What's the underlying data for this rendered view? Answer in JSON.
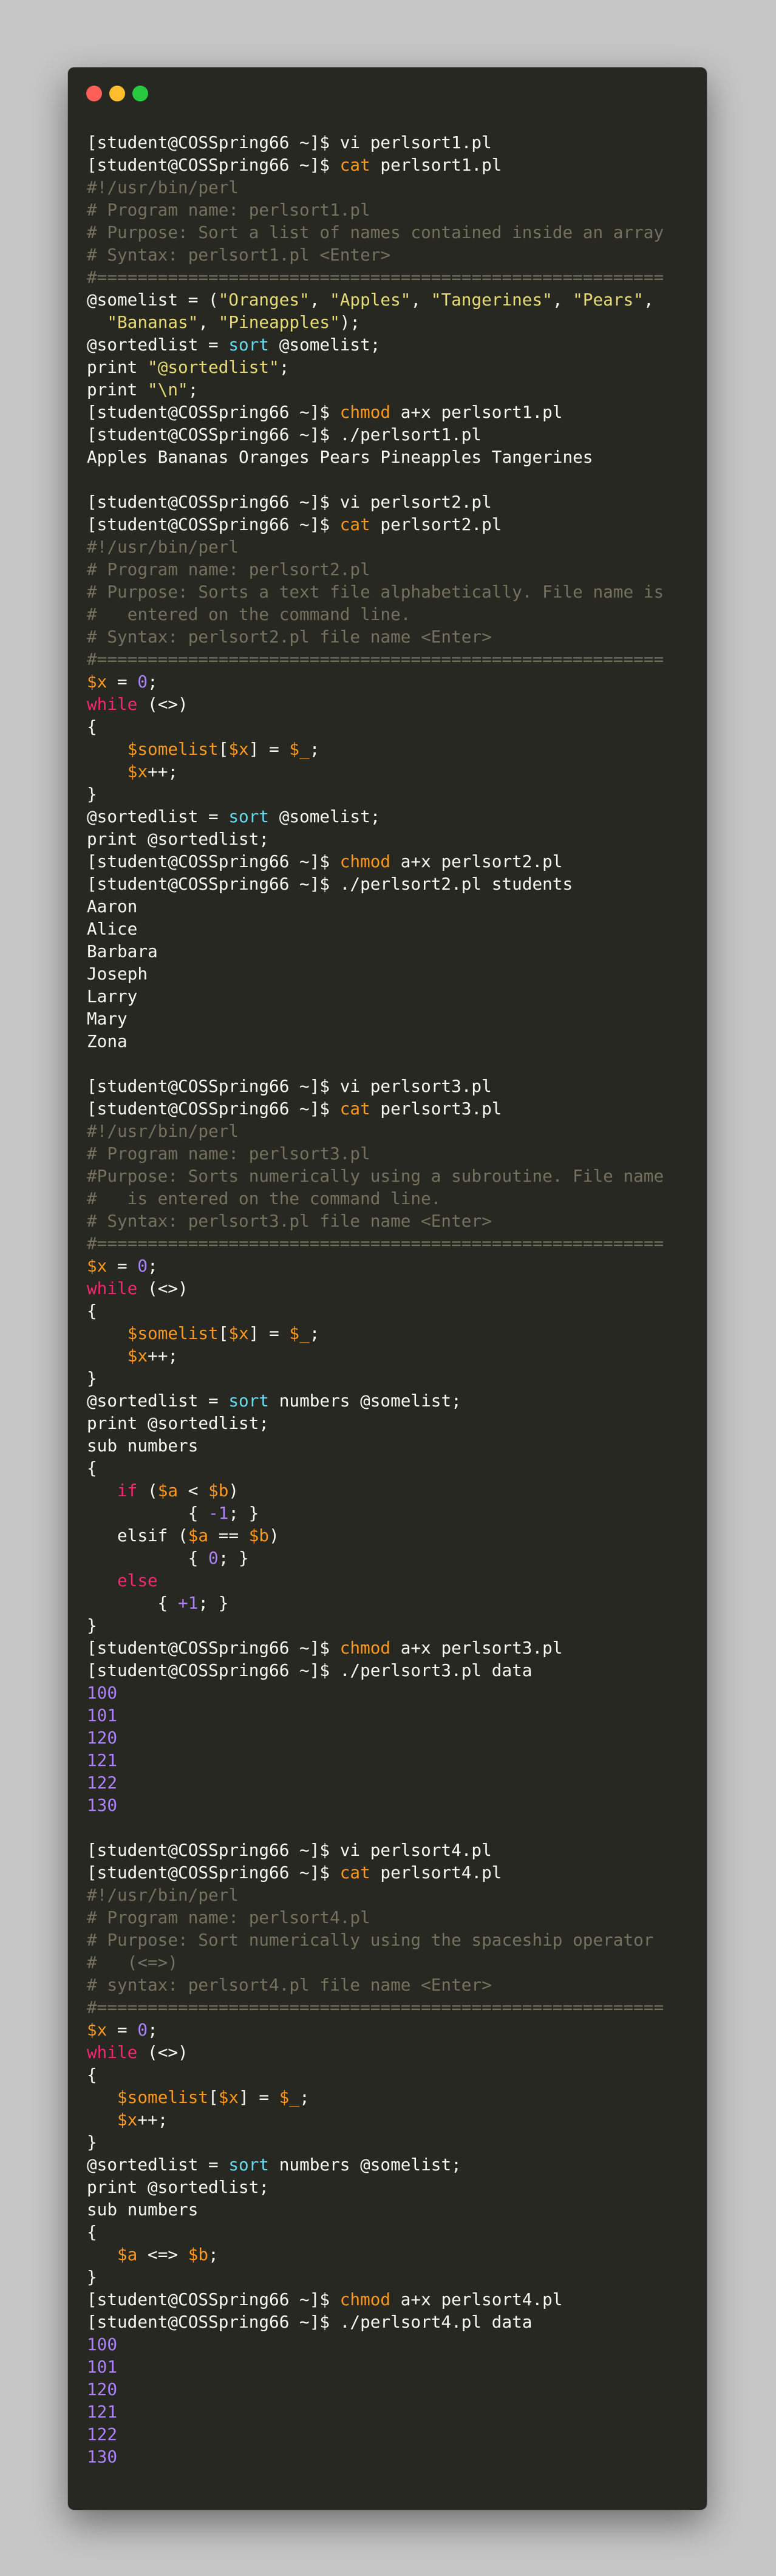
{
  "colors": {
    "background": "#c6c6c6",
    "terminal": "#272822",
    "text": "#f8f8f2",
    "comment": "#75715e",
    "string": "#e6db74",
    "keyword": "#f92672",
    "builtin": "#66d9ef",
    "variable": "#fd971f",
    "number": "#ae81ff"
  },
  "window": {
    "controls": [
      "close",
      "minimize",
      "maximize"
    ]
  },
  "lines": [
    {
      "s": [
        {
          "c": "pr",
          "t": "[student@COSSpring66 ~]$ "
        },
        {
          "c": "cmd",
          "t": "vi perlsort1.pl"
        }
      ]
    },
    {
      "s": [
        {
          "c": "pr",
          "t": "[student@COSSpring66 ~]$ "
        },
        {
          "c": "cmd-hl",
          "t": "cat"
        },
        {
          "c": "cmd",
          "t": " perlsort1.pl"
        }
      ]
    },
    {
      "s": [
        {
          "c": "cm",
          "t": "#!/usr/bin/perl"
        }
      ]
    },
    {
      "s": [
        {
          "c": "cm",
          "t": "# Program name: perlsort1.pl"
        }
      ]
    },
    {
      "s": [
        {
          "c": "cm",
          "t": "# Purpose: Sort a list of names contained inside an array"
        }
      ]
    },
    {
      "s": [
        {
          "c": "cm",
          "t": "# Syntax: perlsort1.pl <Enter>"
        }
      ]
    },
    {
      "s": [
        {
          "c": "cm",
          "t": "#========================================================"
        }
      ]
    },
    {
      "s": [
        {
          "c": "pl",
          "t": "@somelist = ("
        },
        {
          "c": "str",
          "t": "\"Oranges\""
        },
        {
          "c": "pl",
          "t": ", "
        },
        {
          "c": "str",
          "t": "\"Apples\""
        },
        {
          "c": "pl",
          "t": ", "
        },
        {
          "c": "str",
          "t": "\"Tangerines\""
        },
        {
          "c": "pl",
          "t": ", "
        },
        {
          "c": "str",
          "t": "\"Pears\""
        },
        {
          "c": "pl",
          "t": ","
        }
      ]
    },
    {
      "s": [
        {
          "c": "pl",
          "t": "  "
        },
        {
          "c": "str",
          "t": "\"Bananas\""
        },
        {
          "c": "pl",
          "t": ", "
        },
        {
          "c": "str",
          "t": "\"Pineapples\""
        },
        {
          "c": "pl",
          "t": ");"
        }
      ]
    },
    {
      "s": [
        {
          "c": "pl",
          "t": "@sortedlist = "
        },
        {
          "c": "bi",
          "t": "sort"
        },
        {
          "c": "pl",
          "t": " @somelist;"
        }
      ]
    },
    {
      "s": [
        {
          "c": "pl",
          "t": "print "
        },
        {
          "c": "str",
          "t": "\"@sortedlist\""
        },
        {
          "c": "pl",
          "t": ";"
        }
      ]
    },
    {
      "s": [
        {
          "c": "pl",
          "t": "print "
        },
        {
          "c": "str",
          "t": "\"\\n\""
        },
        {
          "c": "pl",
          "t": ";"
        }
      ]
    },
    {
      "s": [
        {
          "c": "pr",
          "t": "[student@COSSpring66 ~]$ "
        },
        {
          "c": "cmd-hl",
          "t": "chmod"
        },
        {
          "c": "cmd",
          "t": " a+x perlsort1.pl"
        }
      ]
    },
    {
      "s": [
        {
          "c": "pr",
          "t": "[student@COSSpring66 ~]$ "
        },
        {
          "c": "cmd",
          "t": "./perlsort1.pl"
        }
      ]
    },
    {
      "s": [
        {
          "c": "out",
          "t": "Apples Bananas Oranges Pears Pineapples Tangerines"
        }
      ]
    },
    {
      "s": []
    },
    {
      "s": [
        {
          "c": "pr",
          "t": "[student@COSSpring66 ~]$ "
        },
        {
          "c": "cmd",
          "t": "vi perlsort2.pl"
        }
      ]
    },
    {
      "s": [
        {
          "c": "pr",
          "t": "[student@COSSpring66 ~]$ "
        },
        {
          "c": "cmd-hl",
          "t": "cat"
        },
        {
          "c": "cmd",
          "t": " perlsort2.pl"
        }
      ]
    },
    {
      "s": [
        {
          "c": "cm",
          "t": "#!/usr/bin/perl"
        }
      ]
    },
    {
      "s": [
        {
          "c": "cm",
          "t": "# Program name: perlsort2.pl"
        }
      ]
    },
    {
      "s": [
        {
          "c": "cm",
          "t": "# Purpose: Sorts a text file alphabetically. File name is"
        }
      ]
    },
    {
      "s": [
        {
          "c": "cm",
          "t": "#   entered on the command line."
        }
      ]
    },
    {
      "s": [
        {
          "c": "cm",
          "t": "# Syntax: perlsort2.pl file name <Enter>"
        }
      ]
    },
    {
      "s": [
        {
          "c": "cm",
          "t": "#========================================================"
        }
      ]
    },
    {
      "s": [
        {
          "c": "var",
          "t": "$x"
        },
        {
          "c": "pl",
          "t": " = "
        },
        {
          "c": "num",
          "t": "0"
        },
        {
          "c": "pl",
          "t": ";"
        }
      ]
    },
    {
      "s": [
        {
          "c": "kw",
          "t": "while"
        },
        {
          "c": "pl",
          "t": " (<>)"
        }
      ]
    },
    {
      "s": [
        {
          "c": "pl",
          "t": "{"
        }
      ]
    },
    {
      "s": [
        {
          "c": "pl",
          "t": "    "
        },
        {
          "c": "var",
          "t": "$somelist"
        },
        {
          "c": "pl",
          "t": "["
        },
        {
          "c": "var",
          "t": "$x"
        },
        {
          "c": "pl",
          "t": "] = "
        },
        {
          "c": "var",
          "t": "$_"
        },
        {
          "c": "pl",
          "t": ";"
        }
      ]
    },
    {
      "s": [
        {
          "c": "pl",
          "t": "    "
        },
        {
          "c": "var",
          "t": "$x"
        },
        {
          "c": "pl",
          "t": "++;"
        }
      ]
    },
    {
      "s": [
        {
          "c": "pl",
          "t": "}"
        }
      ]
    },
    {
      "s": [
        {
          "c": "pl",
          "t": "@sortedlist = "
        },
        {
          "c": "bi",
          "t": "sort"
        },
        {
          "c": "pl",
          "t": " @somelist;"
        }
      ]
    },
    {
      "s": [
        {
          "c": "pl",
          "t": "print @sortedlist;"
        }
      ]
    },
    {
      "s": [
        {
          "c": "pr",
          "t": "[student@COSSpring66 ~]$ "
        },
        {
          "c": "cmd-hl",
          "t": "chmod"
        },
        {
          "c": "cmd",
          "t": " a+x perlsort2.pl"
        }
      ]
    },
    {
      "s": [
        {
          "c": "pr",
          "t": "[student@COSSpring66 ~]$ "
        },
        {
          "c": "cmd",
          "t": "./perlsort2.pl students"
        }
      ]
    },
    {
      "s": [
        {
          "c": "out",
          "t": "Aaron"
        }
      ]
    },
    {
      "s": [
        {
          "c": "out",
          "t": "Alice"
        }
      ]
    },
    {
      "s": [
        {
          "c": "out",
          "t": "Barbara"
        }
      ]
    },
    {
      "s": [
        {
          "c": "out",
          "t": "Joseph"
        }
      ]
    },
    {
      "s": [
        {
          "c": "out",
          "t": "Larry"
        }
      ]
    },
    {
      "s": [
        {
          "c": "out",
          "t": "Mary"
        }
      ]
    },
    {
      "s": [
        {
          "c": "out",
          "t": "Zona"
        }
      ]
    },
    {
      "s": []
    },
    {
      "s": [
        {
          "c": "pr",
          "t": "[student@COSSpring66 ~]$ "
        },
        {
          "c": "cmd",
          "t": "vi perlsort3.pl"
        }
      ]
    },
    {
      "s": [
        {
          "c": "pr",
          "t": "[student@COSSpring66 ~]$ "
        },
        {
          "c": "cmd-hl",
          "t": "cat"
        },
        {
          "c": "cmd",
          "t": " perlsort3.pl"
        }
      ]
    },
    {
      "s": [
        {
          "c": "cm",
          "t": "#!/usr/bin/perl"
        }
      ]
    },
    {
      "s": [
        {
          "c": "cm",
          "t": "# Program name: perlsort3.pl"
        }
      ]
    },
    {
      "s": [
        {
          "c": "cm",
          "t": "#Purpose: Sorts numerically using a subroutine. File name"
        }
      ]
    },
    {
      "s": [
        {
          "c": "cm",
          "t": "#   is entered on the command line."
        }
      ]
    },
    {
      "s": [
        {
          "c": "cm",
          "t": "# Syntax: perlsort3.pl file name <Enter>"
        }
      ]
    },
    {
      "s": [
        {
          "c": "cm",
          "t": "#========================================================"
        }
      ]
    },
    {
      "s": [
        {
          "c": "var",
          "t": "$x"
        },
        {
          "c": "pl",
          "t": " = "
        },
        {
          "c": "num",
          "t": "0"
        },
        {
          "c": "pl",
          "t": ";"
        }
      ]
    },
    {
      "s": [
        {
          "c": "kw",
          "t": "while"
        },
        {
          "c": "pl",
          "t": " (<>)"
        }
      ]
    },
    {
      "s": [
        {
          "c": "pl",
          "t": "{"
        }
      ]
    },
    {
      "s": [
        {
          "c": "pl",
          "t": "    "
        },
        {
          "c": "var",
          "t": "$somelist"
        },
        {
          "c": "pl",
          "t": "["
        },
        {
          "c": "var",
          "t": "$x"
        },
        {
          "c": "pl",
          "t": "] = "
        },
        {
          "c": "var",
          "t": "$_"
        },
        {
          "c": "pl",
          "t": ";"
        }
      ]
    },
    {
      "s": [
        {
          "c": "pl",
          "t": "    "
        },
        {
          "c": "var",
          "t": "$x"
        },
        {
          "c": "pl",
          "t": "++;"
        }
      ]
    },
    {
      "s": [
        {
          "c": "pl",
          "t": "}"
        }
      ]
    },
    {
      "s": [
        {
          "c": "pl",
          "t": "@sortedlist = "
        },
        {
          "c": "bi",
          "t": "sort"
        },
        {
          "c": "pl",
          "t": " numbers @somelist;"
        }
      ]
    },
    {
      "s": [
        {
          "c": "pl",
          "t": "print @sortedlist;"
        }
      ]
    },
    {
      "s": [
        {
          "c": "pl",
          "t": "sub numbers"
        }
      ]
    },
    {
      "s": [
        {
          "c": "pl",
          "t": "{"
        }
      ]
    },
    {
      "s": [
        {
          "c": "pl",
          "t": "   "
        },
        {
          "c": "kw",
          "t": "if"
        },
        {
          "c": "pl",
          "t": " ("
        },
        {
          "c": "var",
          "t": "$a"
        },
        {
          "c": "pl",
          "t": " < "
        },
        {
          "c": "var",
          "t": "$b"
        },
        {
          "c": "pl",
          "t": ")"
        }
      ]
    },
    {
      "s": [
        {
          "c": "pl",
          "t": "          { "
        },
        {
          "c": "num",
          "t": "-1"
        },
        {
          "c": "pl",
          "t": "; }"
        }
      ]
    },
    {
      "s": [
        {
          "c": "pl",
          "t": "   elsif ("
        },
        {
          "c": "var",
          "t": "$a"
        },
        {
          "c": "pl",
          "t": " == "
        },
        {
          "c": "var",
          "t": "$b"
        },
        {
          "c": "pl",
          "t": ")"
        }
      ]
    },
    {
      "s": [
        {
          "c": "pl",
          "t": "          { "
        },
        {
          "c": "num",
          "t": "0"
        },
        {
          "c": "pl",
          "t": "; }"
        }
      ]
    },
    {
      "s": [
        {
          "c": "pl",
          "t": "   "
        },
        {
          "c": "kw",
          "t": "else"
        }
      ]
    },
    {
      "s": [
        {
          "c": "pl",
          "t": "       { "
        },
        {
          "c": "num",
          "t": "+1"
        },
        {
          "c": "pl",
          "t": "; }"
        }
      ]
    },
    {
      "s": [
        {
          "c": "pl",
          "t": "}"
        }
      ]
    },
    {
      "s": [
        {
          "c": "pr",
          "t": "[student@COSSpring66 ~]$ "
        },
        {
          "c": "cmd-hl",
          "t": "chmod"
        },
        {
          "c": "cmd",
          "t": " a+x perlsort3.pl"
        }
      ]
    },
    {
      "s": [
        {
          "c": "pr",
          "t": "[student@COSSpring66 ~]$ "
        },
        {
          "c": "cmd",
          "t": "./perlsort3.pl data"
        }
      ]
    },
    {
      "s": [
        {
          "c": "nout",
          "t": "100"
        }
      ]
    },
    {
      "s": [
        {
          "c": "nout",
          "t": "101"
        }
      ]
    },
    {
      "s": [
        {
          "c": "nout",
          "t": "120"
        }
      ]
    },
    {
      "s": [
        {
          "c": "nout",
          "t": "121"
        }
      ]
    },
    {
      "s": [
        {
          "c": "nout",
          "t": "122"
        }
      ]
    },
    {
      "s": [
        {
          "c": "nout",
          "t": "130"
        }
      ]
    },
    {
      "s": []
    },
    {
      "s": [
        {
          "c": "pr",
          "t": "[student@COSSpring66 ~]$ "
        },
        {
          "c": "cmd",
          "t": "vi perlsort4.pl"
        }
      ]
    },
    {
      "s": [
        {
          "c": "pr",
          "t": "[student@COSSpring66 ~]$ "
        },
        {
          "c": "cmd-hl",
          "t": "cat"
        },
        {
          "c": "cmd",
          "t": " perlsort4.pl"
        }
      ]
    },
    {
      "s": [
        {
          "c": "cm",
          "t": "#!/usr/bin/perl"
        }
      ]
    },
    {
      "s": [
        {
          "c": "cm",
          "t": "# Program name: perlsort4.pl"
        }
      ]
    },
    {
      "s": [
        {
          "c": "cm",
          "t": "# Purpose: Sort numerically using the spaceship operator"
        }
      ]
    },
    {
      "s": [
        {
          "c": "cm",
          "t": "#   (<=>)"
        }
      ]
    },
    {
      "s": [
        {
          "c": "cm",
          "t": "# syntax: perlsort4.pl file name <Enter>"
        }
      ]
    },
    {
      "s": [
        {
          "c": "cm",
          "t": "#========================================================"
        }
      ]
    },
    {
      "s": [
        {
          "c": "var",
          "t": "$x"
        },
        {
          "c": "pl",
          "t": " = "
        },
        {
          "c": "num",
          "t": "0"
        },
        {
          "c": "pl",
          "t": ";"
        }
      ]
    },
    {
      "s": [
        {
          "c": "kw",
          "t": "while"
        },
        {
          "c": "pl",
          "t": " (<>)"
        }
      ]
    },
    {
      "s": [
        {
          "c": "pl",
          "t": "{"
        }
      ]
    },
    {
      "s": [
        {
          "c": "pl",
          "t": "   "
        },
        {
          "c": "var",
          "t": "$somelist"
        },
        {
          "c": "pl",
          "t": "["
        },
        {
          "c": "var",
          "t": "$x"
        },
        {
          "c": "pl",
          "t": "] = "
        },
        {
          "c": "var",
          "t": "$_"
        },
        {
          "c": "pl",
          "t": ";"
        }
      ]
    },
    {
      "s": [
        {
          "c": "pl",
          "t": "   "
        },
        {
          "c": "var",
          "t": "$x"
        },
        {
          "c": "pl",
          "t": "++;"
        }
      ]
    },
    {
      "s": [
        {
          "c": "pl",
          "t": "}"
        }
      ]
    },
    {
      "s": [
        {
          "c": "pl",
          "t": "@sortedlist = "
        },
        {
          "c": "bi",
          "t": "sort"
        },
        {
          "c": "pl",
          "t": " numbers @somelist;"
        }
      ]
    },
    {
      "s": [
        {
          "c": "pl",
          "t": "print @sortedlist;"
        }
      ]
    },
    {
      "s": [
        {
          "c": "pl",
          "t": "sub numbers"
        }
      ]
    },
    {
      "s": [
        {
          "c": "pl",
          "t": "{"
        }
      ]
    },
    {
      "s": [
        {
          "c": "pl",
          "t": "   "
        },
        {
          "c": "var",
          "t": "$a"
        },
        {
          "c": "pl",
          "t": " <=> "
        },
        {
          "c": "var",
          "t": "$b"
        },
        {
          "c": "pl",
          "t": ";"
        }
      ]
    },
    {
      "s": [
        {
          "c": "pl",
          "t": "}"
        }
      ]
    },
    {
      "s": [
        {
          "c": "pr",
          "t": "[student@COSSpring66 ~]$ "
        },
        {
          "c": "cmd-hl",
          "t": "chmod"
        },
        {
          "c": "cmd",
          "t": " a+x perlsort4.pl"
        }
      ]
    },
    {
      "s": [
        {
          "c": "pr",
          "t": "[student@COSSpring66 ~]$ "
        },
        {
          "c": "cmd",
          "t": "./perlsort4.pl data"
        }
      ]
    },
    {
      "s": [
        {
          "c": "nout",
          "t": "100"
        }
      ]
    },
    {
      "s": [
        {
          "c": "nout",
          "t": "101"
        }
      ]
    },
    {
      "s": [
        {
          "c": "nout",
          "t": "120"
        }
      ]
    },
    {
      "s": [
        {
          "c": "nout",
          "t": "121"
        }
      ]
    },
    {
      "s": [
        {
          "c": "nout",
          "t": "122"
        }
      ]
    },
    {
      "s": [
        {
          "c": "nout",
          "t": "130"
        }
      ]
    }
  ]
}
